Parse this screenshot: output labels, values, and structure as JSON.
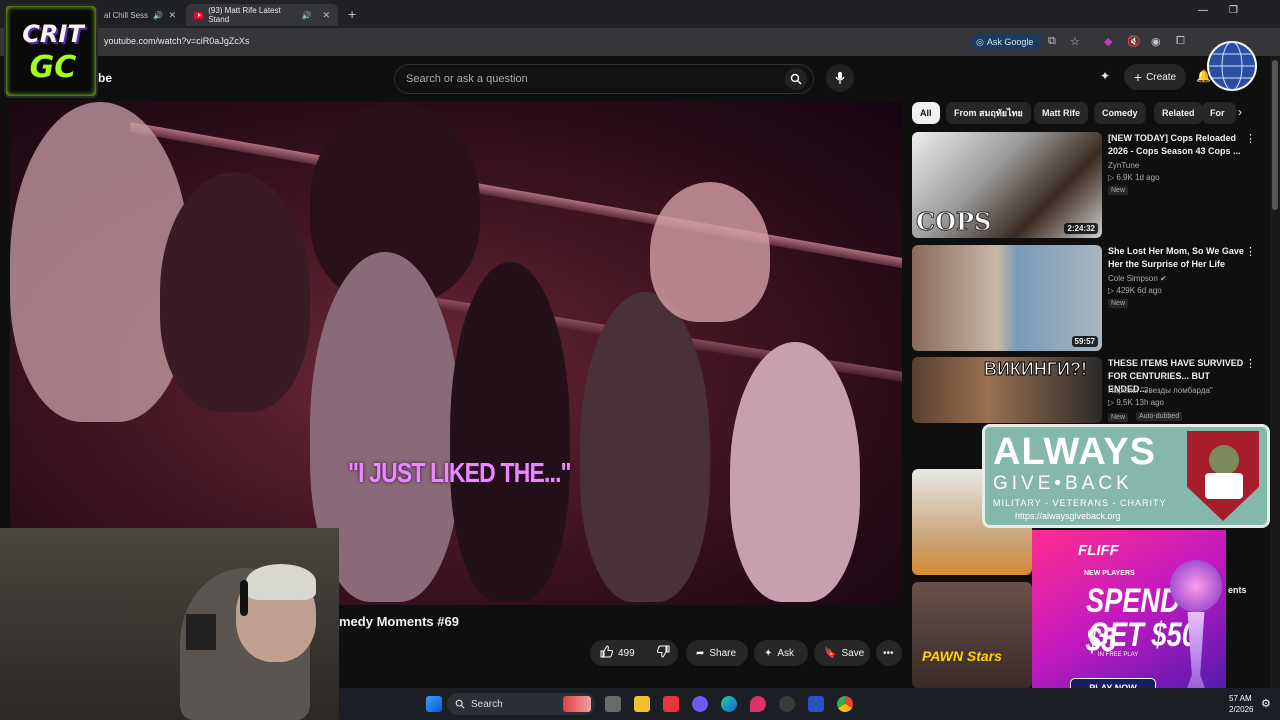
{
  "browser": {
    "tabs": [
      {
        "label": "al Chill Sess",
        "active": false
      },
      {
        "label": "(93) Matt Rife Latest Stand",
        "active": true
      }
    ],
    "url": "youtube.com/watch?v=ciR0aJgZcXs",
    "ask_google": "Ask Google"
  },
  "youtube": {
    "logo_text": "be",
    "search_placeholder": "Search or ask a question",
    "create_label": "Create"
  },
  "video": {
    "subtitle": "\"I JUST LIKED THE...\"",
    "title": "medy Moments #69",
    "likes": "499",
    "share_label": "Share",
    "ask_label": "Ask",
    "save_label": "Save"
  },
  "chips": [
    "All",
    "From สมฤทัยไทย",
    "Matt Rife",
    "Comedy",
    "Related",
    "For"
  ],
  "recommendations": [
    {
      "title": "[NEW TODAY] Cops Reloaded 2026 - Cops Season 43 Cops ...",
      "channel": "ZynTune",
      "meta": "▷ 6.9K   1d ago",
      "badge": "New",
      "duration": "2:24:32",
      "thumb_text": "COPS"
    },
    {
      "title": "She Lost Her Mom, So We Gave Her the Surprise of Her Life",
      "channel": "Cole Simpson ✔",
      "meta": "▷ 429K   6d ago",
      "badge": "New",
      "duration": "59:57",
      "thumb_text": ""
    },
    {
      "title": "THESE ITEMS HAVE SURVIVED FOR CENTURIES... BUT ENDED...",
      "channel": "Нарезки \"Звезды ломбарда\"",
      "meta": "▷ 9.5K   13h ago",
      "badge": "New",
      "badge2": "Auto-dubbed",
      "duration": "",
      "thumb_text": "ВИКИНГИ?!"
    },
    {
      "title": "",
      "channel": "",
      "meta": "",
      "badge": "",
      "duration": "",
      "thumb_text": ""
    },
    {
      "title": "ents",
      "channel": "",
      "meta": "",
      "badge": "",
      "duration": "",
      "thumb_text": "PAWN Stars"
    }
  ],
  "overlays": {
    "crit_line1": "CRIT",
    "crit_line2": "GC",
    "agb_always": "ALWAYS",
    "agb_giveback": "GIVE•BACK",
    "agb_tagline": "MILITARY - VETERANS - CHARITY",
    "agb_url": "https://alwaysgiveback.org",
    "fliff_brand": "FLIFF",
    "fliff_newplayers": "NEW PLAYERS",
    "fliff_line1": "SPEND $5",
    "fliff_line2": "GET $50",
    "fliff_freeplay": "IN FREE PLAY",
    "fliff_cta": "PLAY NOW"
  },
  "taskbar": {
    "search_label": "Search",
    "time": "57 AM",
    "date": "2/2026"
  },
  "colors": {
    "accent_red": "#ff0033",
    "subtitle_pink": "#e88aff",
    "crit_green": "#a3ff1a"
  }
}
